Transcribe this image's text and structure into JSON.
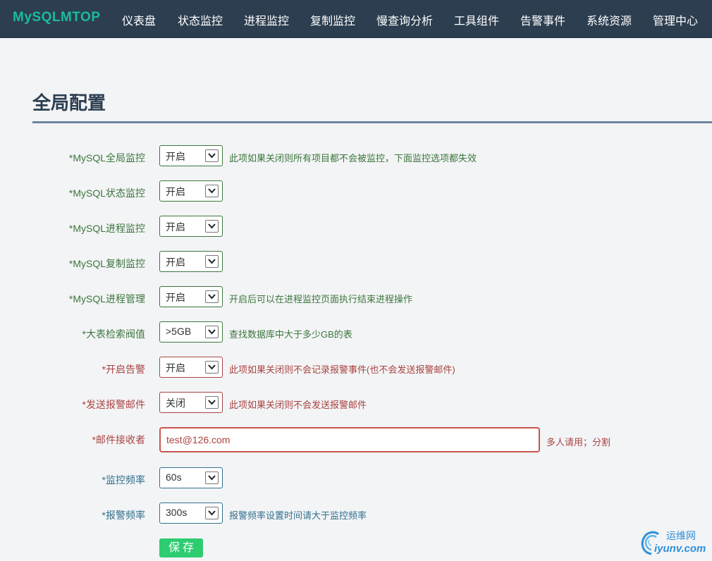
{
  "nav": {
    "brand": "MySQLMTOP",
    "items": [
      "仪表盘",
      "状态监控",
      "进程监控",
      "复制监控",
      "慢查询分析",
      "工具组件",
      "告警事件",
      "系统资源",
      "管理中心"
    ]
  },
  "page": {
    "title": "全局配置"
  },
  "form": {
    "rows": [
      {
        "label": "*MySQL全局监控",
        "value": "开启",
        "help": "此项如果关闭则所有项目都不会被监控，下面监控选项都失效"
      },
      {
        "label": "*MySQL状态监控",
        "value": "开启",
        "help": ""
      },
      {
        "label": "*MySQL进程监控",
        "value": "开启",
        "help": ""
      },
      {
        "label": "*MySQL复制监控",
        "value": "开启",
        "help": ""
      },
      {
        "label": "*MySQL进程管理",
        "value": "开启",
        "help": "开启后可以在进程监控页面执行结束进程操作"
      },
      {
        "label": "*大表检索阀值",
        "value": ">5GB",
        "help": "查找数据库中大于多少GB的表"
      },
      {
        "label": "*开启告警",
        "value": "开启",
        "help": "此项如果关闭则不会记录报警事件(也不会发送报警邮件)"
      },
      {
        "label": "*发送报警邮件",
        "value": "关闭",
        "help": "此项如果关闭则不会发送报警邮件"
      },
      {
        "label": "*邮件接收者",
        "value": "test@126.com",
        "help": "多人请用；分割"
      },
      {
        "label": "*监控频率",
        "value": "60s",
        "help": ""
      },
      {
        "label": "*报警频率",
        "value": "300s",
        "help": "报警频率设置时间请大于监控频率"
      }
    ],
    "save_label": "保存"
  },
  "watermark": {
    "name": "运维网",
    "url": "iyunv.com"
  },
  "colors": {
    "navbar": "#2c3e50",
    "brand": "#1abc9c",
    "success": "#3c763d",
    "error": "#a94442",
    "info": "#31708f",
    "button": "#2ecc71"
  }
}
